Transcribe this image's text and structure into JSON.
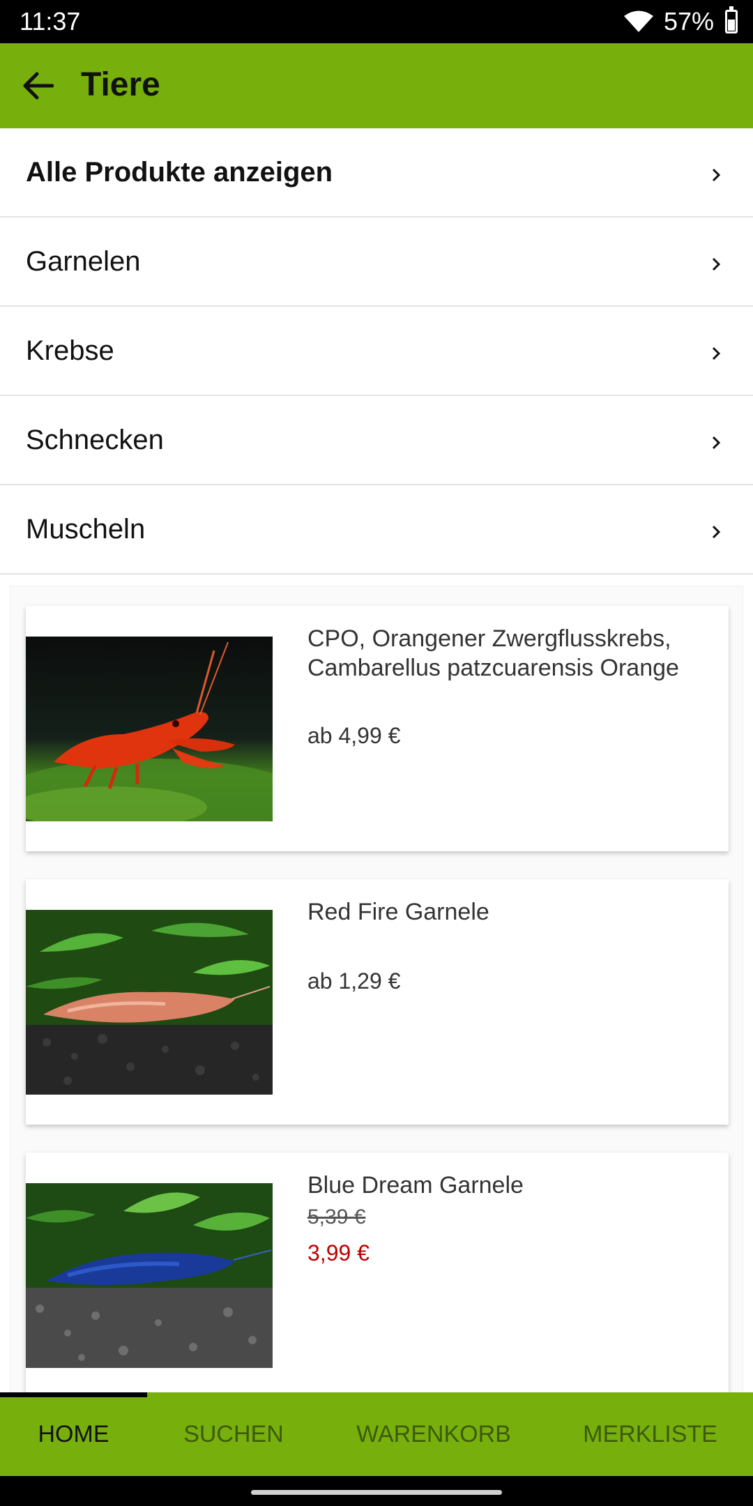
{
  "status_bar": {
    "time": "11:37",
    "battery": "57%",
    "battery_level": 0.57
  },
  "app_bar": {
    "title": "Tiere",
    "back_icon": "arrow-left-icon"
  },
  "categories": [
    {
      "label": "Alle Produkte anzeigen"
    },
    {
      "label": "Garnelen"
    },
    {
      "label": "Krebse"
    },
    {
      "label": "Schnecken"
    },
    {
      "label": "Muscheln"
    }
  ],
  "products": [
    {
      "name": "CPO, Orangener Zwergflusskrebs, Cambarellus patzcuarensis Orange",
      "price": "ab 4,99 €",
      "image": "orange-crayfish-photo"
    },
    {
      "name": "Red Fire Garnele",
      "price": "ab 1,29 €",
      "image": "red-fire-shrimp-photo"
    },
    {
      "name": "Blue Dream Garnele",
      "old_price": "5,39 €",
      "sale_price": "3,99 €",
      "image": "blue-dream-shrimp-photo"
    }
  ],
  "bottom_nav": {
    "tabs": [
      {
        "label": "HOME"
      },
      {
        "label": "SUCHEN"
      },
      {
        "label": "WARENKORB"
      },
      {
        "label": "MERKLISTE"
      }
    ],
    "active_tab": "HOME"
  },
  "colors": {
    "brand_green": "#77b00c",
    "sale_red": "#c00000"
  }
}
